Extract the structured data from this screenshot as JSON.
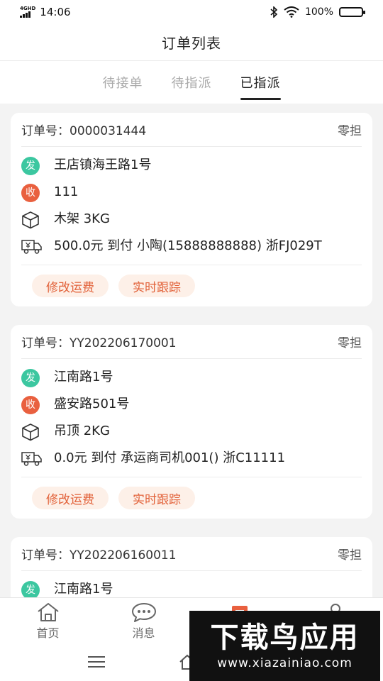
{
  "status_bar": {
    "network": "4GHD",
    "time": "14:06",
    "battery_pct": "100%"
  },
  "nav": {
    "title": "订单列表"
  },
  "tabs": [
    {
      "label": "待接单",
      "active": false
    },
    {
      "label": "待指派",
      "active": false
    },
    {
      "label": "已指派",
      "active": true
    }
  ],
  "orders": [
    {
      "order_label": "订单号：0000031444",
      "type": "零担",
      "send_badge": "发",
      "sender_address": "王店镇海王路1号",
      "recv_badge": "收",
      "receiver_address": "111",
      "goods": "木架  3KG",
      "freight": "500.0元  到付  小陶(15888888888)  浙FJ029T",
      "actions": [
        "修改运费",
        "实时跟踪"
      ]
    },
    {
      "order_label": "订单号：YY202206170001",
      "type": "零担",
      "send_badge": "发",
      "sender_address": "江南路1号",
      "recv_badge": "收",
      "receiver_address": "盛安路501号",
      "goods": "吊顶  2KG",
      "freight": "0.0元  到付  承运商司机001()  浙C11111",
      "actions": [
        "修改运费",
        "实时跟踪"
      ]
    },
    {
      "order_label": "订单号：YY202206160011",
      "type": "零担",
      "send_badge": "发",
      "sender_address": "江南路1号"
    }
  ],
  "tabbar": [
    {
      "label": "首页",
      "icon": "home-icon"
    },
    {
      "label": "消息",
      "icon": "message-icon"
    }
  ],
  "watermark": {
    "title": "下载鸟应用",
    "url": "www.xiazainiao.com"
  },
  "colors": {
    "accent": "#e9603f",
    "send_badge": "#3cc7a0",
    "button_bg": "#fdf0e8"
  }
}
